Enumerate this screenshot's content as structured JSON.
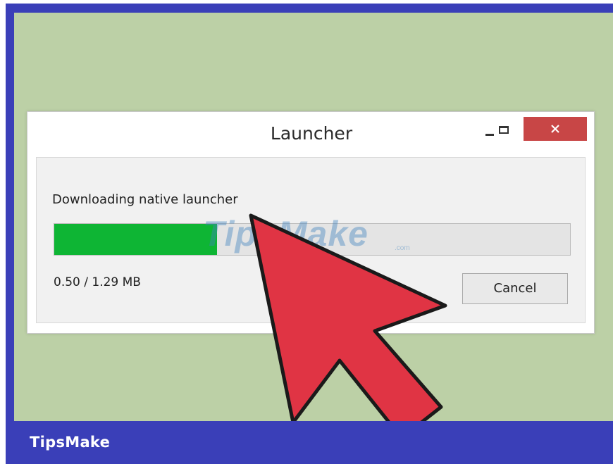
{
  "window": {
    "title": "Launcher",
    "controls": {
      "minimize": "minimize-icon",
      "maximize": "maximize-icon",
      "close": "close-icon"
    }
  },
  "download": {
    "status_label": "Downloading native launcher",
    "progress": 0.315,
    "size_text": "0.50 / 1.29 MB"
  },
  "cancel_label": "Cancel",
  "watermark": {
    "text": "TipsMake",
    "suffix": ".com"
  },
  "brand": "TipsMake",
  "colors": {
    "frame": "#3a3fb8",
    "backdrop": "#bcd0a6",
    "progress_fill": "#0eb534",
    "close_button": "#c84646",
    "arrow": "#e03444"
  }
}
